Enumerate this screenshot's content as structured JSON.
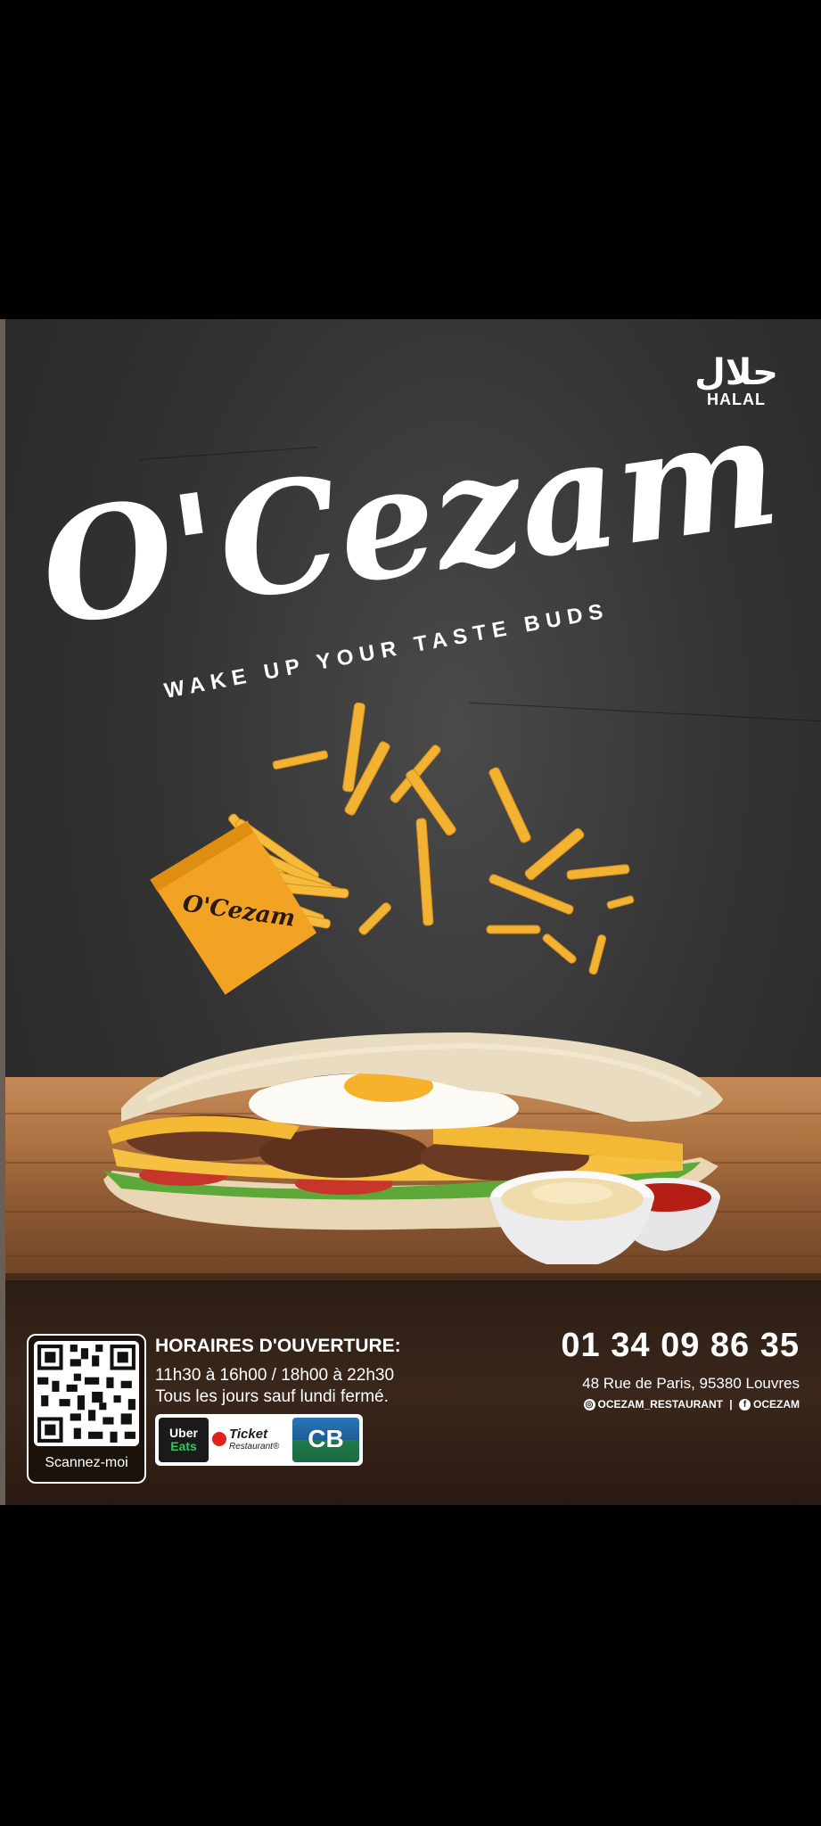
{
  "halal": {
    "arabic": "حلال",
    "label": "HALAL"
  },
  "brand": {
    "logo_text": "O'Cezam",
    "tagline": "WAKE UP YOUR TASTE BUDS"
  },
  "fries_box": {
    "logo_text": "O'Cezam"
  },
  "footer": {
    "qr_label": "Scannez-moi",
    "hours_title": "HORAIRES D'OUVERTURE:",
    "hours_line1": "11h30 à 16h00 / 18h00 à 22h30",
    "hours_line2": "Tous les jours sauf lundi fermé.",
    "payments": {
      "uber_line1": "Uber",
      "uber_line2": "Eats",
      "ticket_line1": "Ticket",
      "ticket_line2": "Restaurant®",
      "cb": "CB"
    },
    "phone": "01 34 09 86 35",
    "address": "48 Rue de Paris, 95380 Louvres",
    "instagram": "OCEZAM_RESTAURANT",
    "facebook": "OCEZAM",
    "instagram_icon": "instagram-icon",
    "facebook_icon": "facebook-icon"
  },
  "colors": {
    "accent_orange": "#f2a324",
    "background": "#2f2f2f",
    "wood": "#b07443",
    "footer_brown": "#2c1d14"
  }
}
